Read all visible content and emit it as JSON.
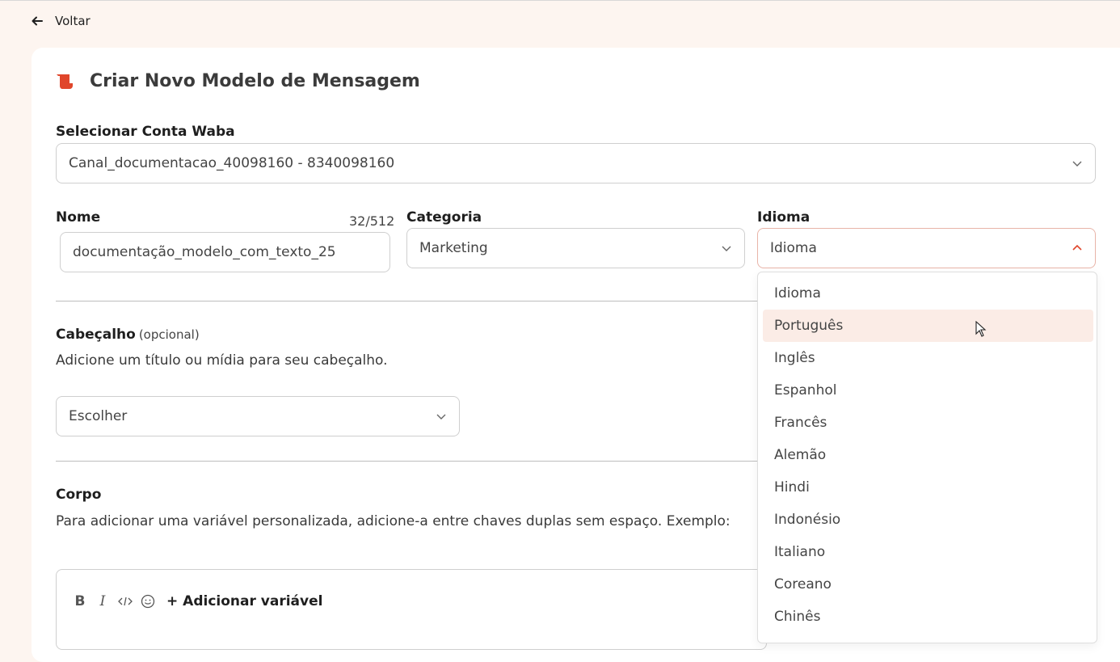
{
  "header": {
    "back_label": "Voltar"
  },
  "page": {
    "title": "Criar Novo Modelo de Mensagem",
    "accent_color": "#e0462b"
  },
  "waba": {
    "label": "Selecionar Conta Waba",
    "value": "Canal_documentacao_40098160 - 8340098160"
  },
  "name_field": {
    "label": "Nome",
    "counter": "32/512",
    "value": "documentação_modelo_com_texto_25"
  },
  "category": {
    "label": "Categoria",
    "value": "Marketing"
  },
  "language": {
    "label": "Idioma",
    "value": "Idioma",
    "options": [
      "Idioma",
      "Português",
      "Inglês",
      "Espanhol",
      "Francês",
      "Alemão",
      "Hindi",
      "Indonésio",
      "Italiano",
      "Coreano",
      "Chinês"
    ],
    "highlighted": "Português"
  },
  "header_section": {
    "title": "Cabeçalho",
    "optional": "(opcional)",
    "description": "Adicione um título ou mídia para seu cabeçalho.",
    "select_value": "Escolher"
  },
  "body_section": {
    "title": "Corpo",
    "description": "Para adicionar uma variável personalizada, adicione-a entre chaves duplas sem espaço. Exemplo:",
    "toolbar": {
      "bold": "B",
      "italic": "I",
      "add_variable": "+ Adicionar variável"
    }
  }
}
